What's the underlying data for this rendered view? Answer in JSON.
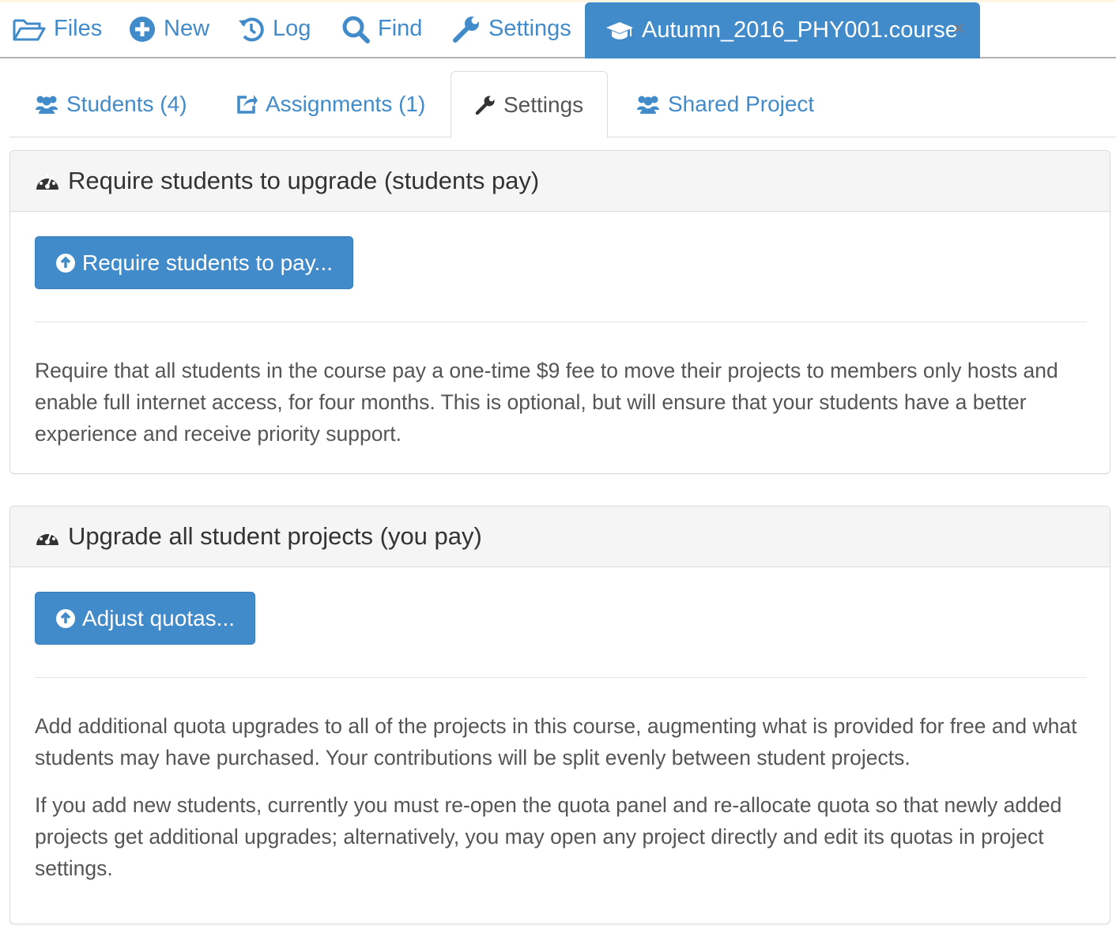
{
  "topbar": {
    "files": "Files",
    "new": "New",
    "log": "Log",
    "find": "Find",
    "settings": "Settings",
    "active_file": "Autumn_2016_PHY001.course",
    "close": "×"
  },
  "tabs": {
    "students": "Students (4)",
    "assignments": "Assignments (1)",
    "settings": "Settings",
    "shared_project": "Shared Project"
  },
  "panel1": {
    "title": "Require students to upgrade (students pay)",
    "button": "Require students to pay...",
    "text": "Require that all students in the course pay a one-time $9 fee to move their projects to members only hosts and enable full internet access, for four months. This is optional, but will ensure that your students have a better experience and receive priority support."
  },
  "panel2": {
    "title": "Upgrade all student projects (you pay)",
    "button": "Adjust quotas...",
    "text1": "Add additional quota upgrades to all of the projects in this course, augmenting what is provided for free and what students may have purchased. Your contributions will be split evenly between student projects.",
    "text2": "If you add new students, currently you must re-open the quota panel and re-allocate quota so that newly added projects get additional upgrades; alternatively, you may open any project directly and edit its quotas in project settings."
  },
  "colors": {
    "accent": "#428bca",
    "panel_bg": "#f5f5f5",
    "border": "#dcdcdc"
  }
}
